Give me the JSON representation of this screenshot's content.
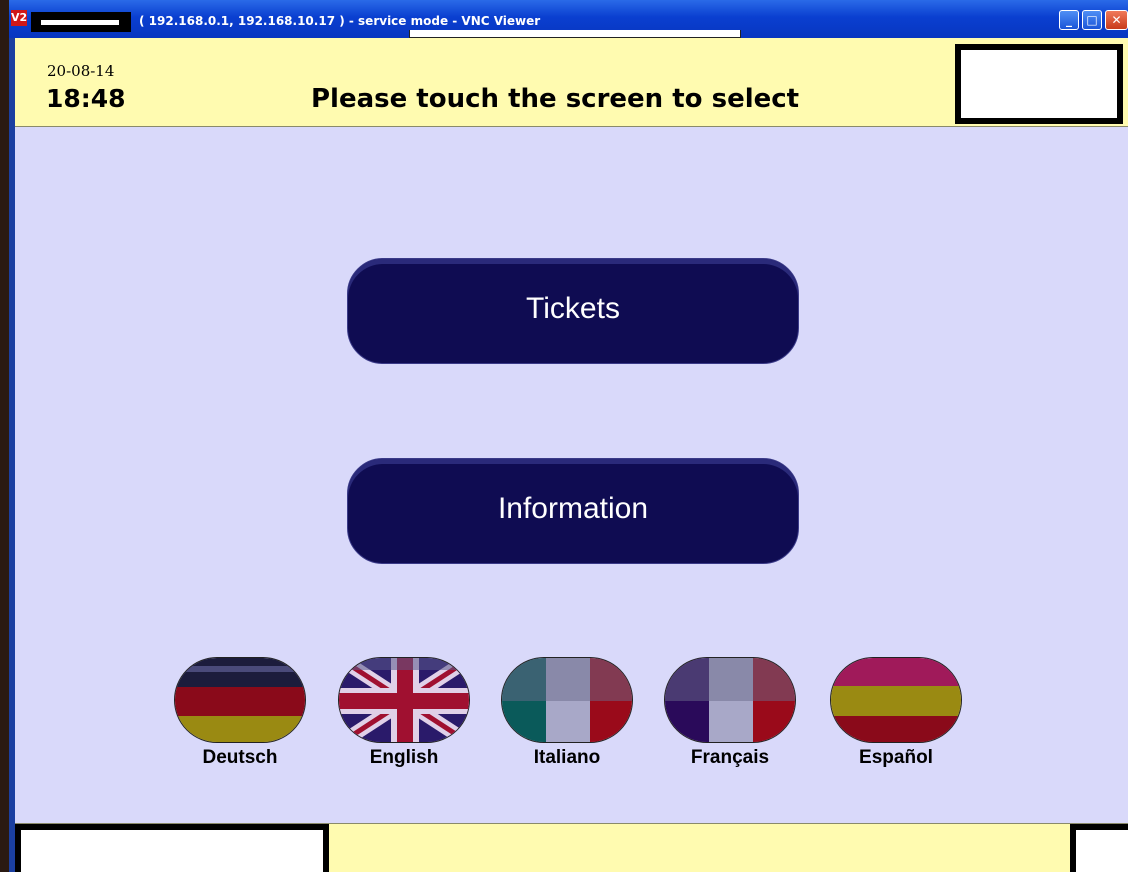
{
  "window": {
    "app_icon": "V2",
    "title": "( 192.168.0.1, 192.168.10.17 ) - service mode - VNC Viewer",
    "controls": {
      "minimize": "_",
      "maximize": "□",
      "close": "✕"
    }
  },
  "header": {
    "date": "20-08-14",
    "time": "18:48",
    "prompt": "Please touch the screen to select"
  },
  "menu": {
    "tickets_label": "Tickets",
    "information_label": "Information"
  },
  "languages": [
    {
      "label": "Deutsch",
      "flag": "germany-flag"
    },
    {
      "label": "English",
      "flag": "uk-flag"
    },
    {
      "label": "Italiano",
      "flag": "italy-flag"
    },
    {
      "label": "Français",
      "flag": "france-flag"
    },
    {
      "label": "Español",
      "flag": "spain-flag"
    }
  ],
  "colors": {
    "header_bg": "#fffbb0",
    "body_bg": "#d9d9fa",
    "button_bg": "#0f0c52"
  }
}
